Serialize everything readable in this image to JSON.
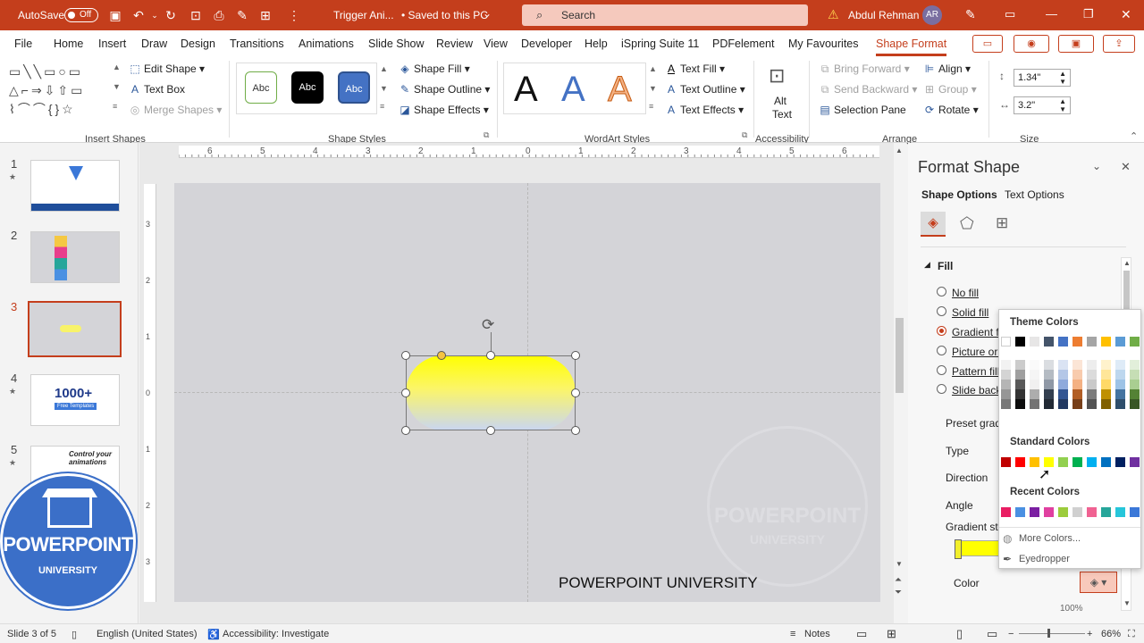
{
  "titlebar": {
    "autosave_label": "AutoSave",
    "autosave_state": "Off",
    "doc_title": "Trigger Ani...",
    "save_state": "• Saved to this PC",
    "search_placeholder": "Search",
    "user_name": "Abdul Rehman",
    "user_initials": "AR",
    "accent": "#c43e1c"
  },
  "tabs": [
    "File",
    "Home",
    "Insert",
    "Draw",
    "Design",
    "Transitions",
    "Animations",
    "Slide Show",
    "Review",
    "View",
    "Developer",
    "Help",
    "iSpring Suite 11",
    "PDFelement",
    "My Favourites",
    "Shape Format"
  ],
  "active_tab": "Shape Format",
  "ribbon": {
    "edit_shape": "Edit Shape",
    "text_box": "Text Box",
    "merge_shapes": "Merge Shapes",
    "insert_shapes": "Insert Shapes",
    "style_sample": "Abc",
    "shape_fill": "Shape Fill",
    "shape_outline": "Shape Outline",
    "shape_effects": "Shape Effects",
    "shape_styles": "Shape Styles",
    "wordart_letter": "A",
    "text_fill": "Text Fill",
    "text_outline": "Text Outline",
    "text_effects": "Text Effects",
    "wordart_styles": "WordArt Styles",
    "alt_text_1": "Alt",
    "alt_text_2": "Text",
    "accessibility": "Accessibility",
    "bring_forward": "Bring Forward",
    "send_backward": "Send Backward",
    "selection_pane": "Selection Pane",
    "align": "Align",
    "group": "Group",
    "rotate": "Rotate",
    "arrange": "Arrange",
    "height": "1.34\"",
    "width": "3.2\"",
    "size": "Size"
  },
  "slides": [
    {
      "num": "1",
      "star": "★"
    },
    {
      "num": "2",
      "star": ""
    },
    {
      "num": "3",
      "star": ""
    },
    {
      "num": "4",
      "star": "★"
    },
    {
      "num": "5",
      "star": "★"
    }
  ],
  "selected_slide": "3",
  "thumb4_text": "1000+",
  "thumb4_sub": "Free Templates",
  "thumb5_text": "Control your animations",
  "ruler_top": [
    "6",
    "5",
    "4",
    "3",
    "2",
    "1",
    "0",
    "1",
    "2",
    "3",
    "4",
    "5",
    "6"
  ],
  "ruler_left": [
    "3",
    "2",
    "1",
    "0",
    "1",
    "2",
    "3"
  ],
  "slide": {
    "footer_text": "POWERPOINT UNIVERSITY",
    "watermark_1": "POWERPOINT",
    "watermark_2": "UNIVERSITY",
    "logo_1": "POWERPOINT",
    "logo_2": "UNIVERSITY"
  },
  "pane": {
    "title": "Format Shape",
    "tab_shape": "Shape Options",
    "tab_text": "Text Options",
    "section": "Fill",
    "options": [
      "No fill",
      "Solid fill",
      "Gradient fi",
      "Picture or t",
      "Pattern fill",
      "Slide backg"
    ],
    "selected_option": "Gradient fi",
    "preset": "Preset gradi",
    "type": "Type",
    "direction": "Direction",
    "angle": "Angle",
    "stops": "Gradient sto",
    "color": "Color",
    "position_val": "100%"
  },
  "popup": {
    "theme_label": "Theme Colors",
    "standard_label": "Standard Colors",
    "recent_label": "Recent Colors",
    "more_colors": "More Colors...",
    "eyedropper": "Eyedropper",
    "theme_top": [
      "#ffffff",
      "#000000",
      "#e7e6e6",
      "#44546a",
      "#4472c4",
      "#ed7d31",
      "#a5a5a5",
      "#ffc000",
      "#5b9bd5",
      "#70ad47"
    ],
    "standard": [
      "#c00000",
      "#ff0000",
      "#ffc000",
      "#ffff00",
      "#92d050",
      "#00b050",
      "#00b0f0",
      "#0070c0",
      "#002060",
      "#7030a0"
    ],
    "recent": [
      "#e91e63",
      "#4a90e2",
      "#7b1fa2",
      "#e040a0",
      "#9ccc3c",
      "#d0d0d0",
      "#f06292",
      "#26a69a",
      "#26c6da",
      "#3b78d8"
    ]
  },
  "status": {
    "slide_of": "Slide 3 of 5",
    "language": "English (United States)",
    "accessibility": "Accessibility: Investigate",
    "notes": "Notes",
    "zoom": "66%"
  }
}
